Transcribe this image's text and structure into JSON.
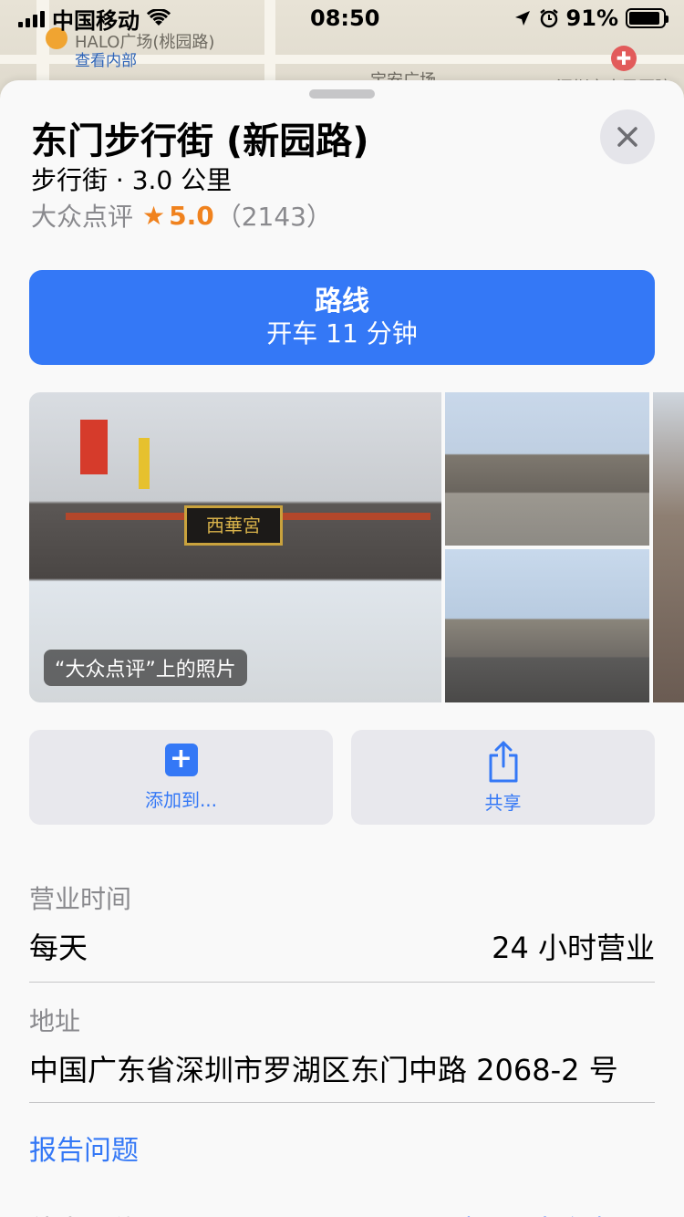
{
  "status_bar": {
    "carrier": "中国移动",
    "time": "08:50",
    "battery_percent": "91%",
    "battery_level": 0.91
  },
  "map": {
    "label_top": "HALO广场(桃园路)",
    "link": "查看内部",
    "label_bottom": "宝安广场",
    "label_right": "深圳市人民医院"
  },
  "place": {
    "title": "东门步行街 (新园路)",
    "subtitle": "步行街 · 3.0 公里",
    "rating_source": "大众点评",
    "rating_star": "★",
    "rating_value": "5.0",
    "rating_count": "（2143）"
  },
  "route": {
    "label": "路线",
    "sub": "开车 11 分钟"
  },
  "photos": {
    "caption": "“大众点评”上的照片",
    "sign_text": "西華宮"
  },
  "actions": {
    "add_label": "添加到...",
    "add_icon": "+",
    "share_label": "共享"
  },
  "hours": {
    "heading": "营业时间",
    "day": "每天",
    "value": "24 小时营业"
  },
  "address": {
    "heading": "地址",
    "value": "中国广东省深圳市罗湖区东门中路 2068-2 号"
  },
  "report": {
    "label": "报告问题"
  },
  "more": {
    "left": "他人评价",
    "right": "打开“大众点评”"
  },
  "colors": {
    "accent": "#3478f6",
    "rating": "#f0821e"
  }
}
